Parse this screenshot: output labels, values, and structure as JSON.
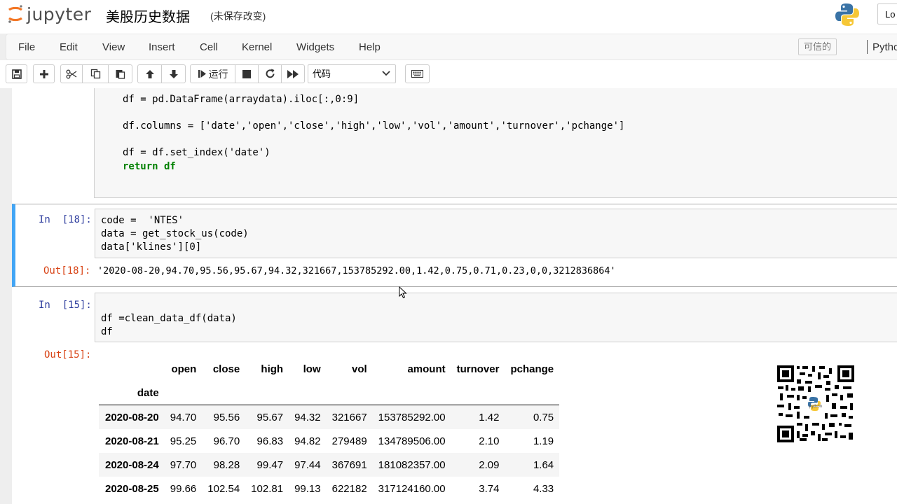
{
  "header": {
    "logo_text": "jupyter",
    "notebook_title": "美股历史数据",
    "save_status": "(未保存改变)",
    "login_label": "Lo"
  },
  "menu": {
    "items": [
      "File",
      "Edit",
      "View",
      "Insert",
      "Cell",
      "Kernel",
      "Widgets",
      "Help"
    ],
    "trusted_label": "可信的",
    "kernel_name": "Python"
  },
  "toolbar": {
    "run_label": "运行",
    "cell_type": "代码"
  },
  "cells": {
    "prev_code": {
      "line1": "df = pd.DataFrame(arraydata).iloc[:,0:9]",
      "line2": "df.columns = ['date','open','close','high','low','vol','amount','turnover','pchange']",
      "line3": "df = df.set_index('date')",
      "line4": "return df"
    },
    "cell18": {
      "in_prompt": "In  [18]:",
      "line1": "code =  'NTES'",
      "line2": "data = get_stock_us(code)",
      "line3": "data['klines'][0]",
      "out_prompt": "Out[18]:",
      "output": "'2020-08-20,94.70,95.56,95.67,94.32,321667,153785292.00,1.42,0.75,0.71,0.23,0,0,3212836864'"
    },
    "cell15": {
      "in_prompt": "In  [15]:",
      "line1": "df =clean_data_df(data)",
      "line2": "df",
      "out_prompt": "Out[15]:"
    }
  },
  "dataframe": {
    "columns": [
      "open",
      "close",
      "high",
      "low",
      "vol",
      "amount",
      "turnover",
      "pchange"
    ],
    "index_name": "date",
    "rows": [
      {
        "date": "2020-08-20",
        "values": [
          "94.70",
          "95.56",
          "95.67",
          "94.32",
          "321667",
          "153785292.00",
          "1.42",
          "0.75"
        ]
      },
      {
        "date": "2020-08-21",
        "values": [
          "95.25",
          "96.70",
          "96.83",
          "94.82",
          "279489",
          "134789506.00",
          "2.10",
          "1.19"
        ]
      },
      {
        "date": "2020-08-24",
        "values": [
          "97.70",
          "98.28",
          "99.47",
          "97.44",
          "367691",
          "181082357.00",
          "2.09",
          "1.64"
        ]
      },
      {
        "date": "2020-08-25",
        "values": [
          "99.66",
          "102.54",
          "102.81",
          "99.13",
          "622182",
          "317124160.00",
          "3.74",
          "4.33"
        ]
      }
    ]
  },
  "qr_center_label": "python"
}
